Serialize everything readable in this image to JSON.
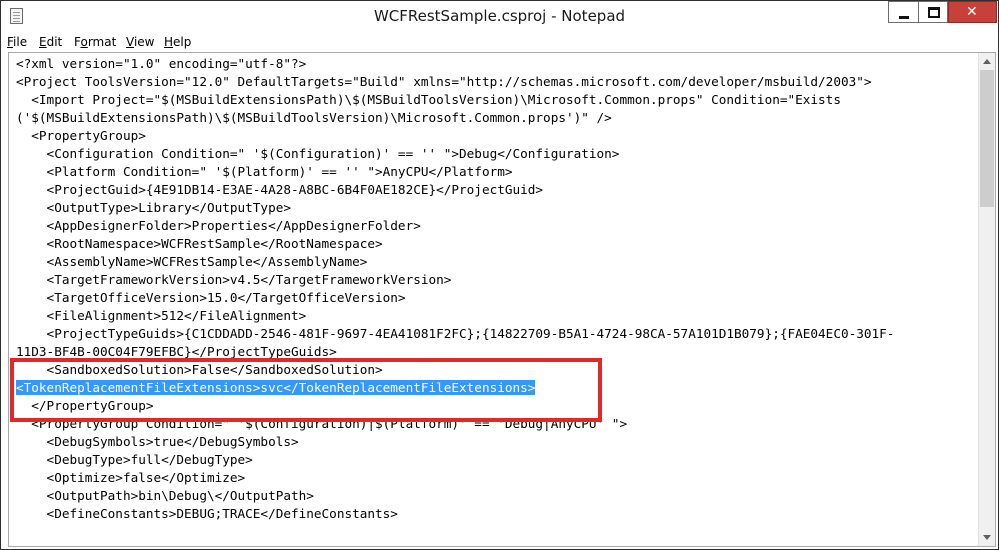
{
  "window": {
    "title": "WCFRestSample.csproj - Notepad",
    "controls": {
      "minimize": "minimize",
      "maximize": "maximize",
      "close": "✕"
    }
  },
  "menu": {
    "items": [
      "File",
      "Edit",
      "Format",
      "View",
      "Help"
    ],
    "mnemonics": [
      "F",
      "E",
      "o",
      "V",
      "H"
    ]
  },
  "editor": {
    "lines": [
      "<?xml version=\"1.0\" encoding=\"utf-8\"?>",
      "<Project ToolsVersion=\"12.0\" DefaultTargets=\"Build\" xmlns=\"http://schemas.microsoft.com/developer/msbuild/2003\">",
      "  <Import Project=\"$(MSBuildExtensionsPath)\\$(MSBuildToolsVersion)\\Microsoft.Common.props\" Condition=\"Exists",
      "('$(MSBuildExtensionsPath)\\$(MSBuildToolsVersion)\\Microsoft.Common.props')\" />",
      "  <PropertyGroup>",
      "    <Configuration Condition=\" '$(Configuration)' == '' \">Debug</Configuration>",
      "    <Platform Condition=\" '$(Platform)' == '' \">AnyCPU</Platform>",
      "    <ProjectGuid>{4E91DB14-E3AE-4A28-A8BC-6B4F0AE182CE}</ProjectGuid>",
      "    <OutputType>Library</OutputType>",
      "    <AppDesignerFolder>Properties</AppDesignerFolder>",
      "    <RootNamespace>WCFRestSample</RootNamespace>",
      "    <AssemblyName>WCFRestSample</AssemblyName>",
      "    <TargetFrameworkVersion>v4.5</TargetFrameworkVersion>",
      "    <TargetOfficeVersion>15.0</TargetOfficeVersion>",
      "    <FileAlignment>512</FileAlignment>",
      "    <ProjectTypeGuids>{C1CDDADD-2546-481F-9697-4EA41081F2FC};{14822709-B5A1-4724-98CA-57A101D1B079};{FAE04EC0-301F-",
      "11D3-BF4B-00C04F79EFBC}</ProjectTypeGuids>",
      "    <SandboxedSolution>False</SandboxedSolution>",
      "<TokenReplacementFileExtensions>svc</TokenReplacementFileExtensions>",
      "  </PropertyGroup>",
      "  <PropertyGroup Condition=\" '$(Configuration)|$(Platform)' == 'Debug|AnyCPU' \">",
      "    <DebugSymbols>true</DebugSymbols>",
      "    <DebugType>full</DebugType>",
      "    <Optimize>false</Optimize>",
      "    <OutputPath>bin\\Debug\\</OutputPath>",
      "    <DefineConstants>DEBUG;TRACE</DefineConstants>"
    ],
    "selected_line": "<TokenReplacementFileExtensions>svc</TokenReplacementFileExtensions>"
  },
  "colors": {
    "selection": "#3399ff",
    "annotation_box": "#e02a2a",
    "close_button": "#c7403a"
  }
}
